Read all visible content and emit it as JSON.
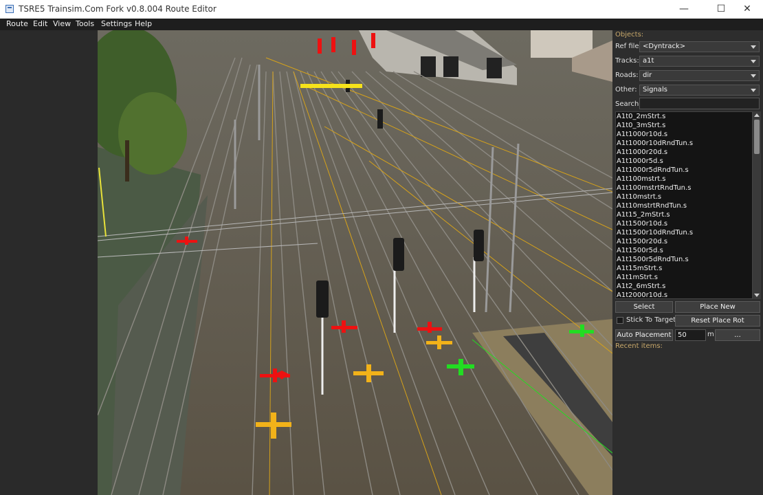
{
  "window": {
    "title": "TSRE5 Trainsim.Com Fork v0.8.004 Route Editor",
    "minimize": "—",
    "maximize": "☐",
    "close": "✕"
  },
  "menu": [
    "Route",
    "Edit",
    "View",
    "Tools",
    "Settings",
    "Help"
  ],
  "viewport": {
    "scene": "3D railway yard with tracks, signals and overhead catenary",
    "colors": {
      "ballast": "#5d5547",
      "rail": "#9a9a9a",
      "placeholder_red": "#ee1111",
      "placeholder_yellow": "#f2b219",
      "placeholder_green": "#22dd22"
    }
  },
  "objects_panel": {
    "heading": "Objects:",
    "ref_file_label": "Ref file:",
    "ref_file_value": "<Dyntrack>",
    "tracks_label": "Tracks:",
    "tracks_value": "a1t",
    "roads_label": "Roads:",
    "roads_value": "dir",
    "other_label": "Other:",
    "other_value": "Signals",
    "search_label": "Search:",
    "search_value": "",
    "items": [
      "A1t0_2mStrt.s",
      "A1t0_3mStrt.s",
      "A1t1000r10d.s",
      "A1t1000r10dRndTun.s",
      "A1t1000r20d.s",
      "A1t1000r5d.s",
      "A1t1000r5dRndTun.s",
      "A1t100mstrt.s",
      "A1t100mstrtRndTun.s",
      "A1t10mstrt.s",
      "A1t10mstrtRndTun.s",
      "A1t15_2mStrt.s",
      "A1t1500r10d.s",
      "A1t1500r10dRndTun.s",
      "A1t1500r20d.s",
      "A1t1500r5d.s",
      "A1t1500r5dRndTun.s",
      "A1t15mStrt.s",
      "A1t1mStrt.s",
      "A1t2_6mStrt.s",
      "A1t2000r10d.s"
    ],
    "select_button": "Select",
    "place_new_button": "Place New",
    "stick_to_target_label": "Stick To Target",
    "reset_place_rot_button": "Reset Place Rot",
    "auto_placement_button": "Auto Placement",
    "placement_distance": "50",
    "distance_unit": "m",
    "more_button": "...",
    "recent_heading": "Recent items:"
  }
}
